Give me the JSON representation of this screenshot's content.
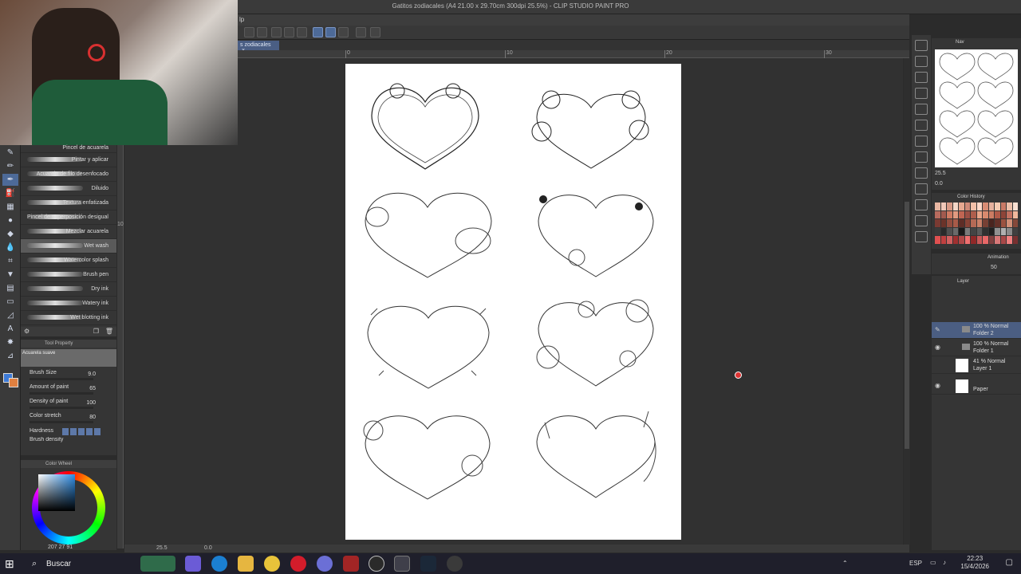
{
  "window": {
    "title": "Gatitos zodiacales (A4 21.00 x 29.70cm 300dpi 25.5%) - CLIP STUDIO PAINT PRO"
  },
  "menu": {
    "partial_label": "lp"
  },
  "document_tab": {
    "label": "s zodiacales",
    "close": "×"
  },
  "ruler": {
    "labels": [
      "0",
      "10",
      "20",
      "30"
    ],
    "left_label": "10"
  },
  "brushes": [
    {
      "label": "Pincel de acuarela"
    },
    {
      "label": "Pintar y aplicar"
    },
    {
      "label": "Acuarela de filo desenfocado"
    },
    {
      "label": "Diluido"
    },
    {
      "label": "Textura enfatizada"
    },
    {
      "label": "Pincel de superposición desigual"
    },
    {
      "label": "Mezclar acuarela"
    },
    {
      "label": "Wet wash"
    },
    {
      "label": "Watercolor splash"
    },
    {
      "label": "Brush pen"
    },
    {
      "label": "Dry ink"
    },
    {
      "label": "Watery ink"
    },
    {
      "label": "Wet blotting ink"
    }
  ],
  "tool_property": {
    "title": "Tool Property",
    "preset": "Acuarela suave",
    "props": [
      {
        "name": "Brush Size",
        "value": "9.0"
      },
      {
        "name": "Amount of paint",
        "value": "65"
      },
      {
        "name": "Density of paint",
        "value": "100"
      },
      {
        "name": "Color stretch",
        "value": "80"
      }
    ],
    "hardness_label": "Hardness",
    "cut_label": "Brush density"
  },
  "color_wheel": {
    "title": "Color Wheel",
    "values": "207 27 91"
  },
  "navigator": {
    "title": "Nav",
    "zoom": "25.5",
    "rotation": "0.0"
  },
  "color_history": {
    "title": "Color History",
    "colors": [
      "#e8b6a2",
      "#f0c8b8",
      "#d99a86",
      "#f4d6c6",
      "#e6a890",
      "#cf8a78",
      "#f2c0a8",
      "#ffd9c9",
      "#d88c74",
      "#e7b29e",
      "#f6cbb2",
      "#c97a66",
      "#ecbfa9",
      "#fae0d2",
      "#b86b5e",
      "#a35a4e",
      "#d07a62",
      "#e29a80",
      "#c06552",
      "#9c4f44",
      "#ae5e4c",
      "#e8a488",
      "#d88a6e",
      "#cc7c62",
      "#b05a48",
      "#8e4438",
      "#c27060",
      "#f0b89c",
      "#7a3a32",
      "#6b3329",
      "#934d3f",
      "#a85a48",
      "#5e2d26",
      "#874235",
      "#b56a56",
      "#c98068",
      "#774034",
      "#4a241e",
      "#633028",
      "#9b5240",
      "#d29078",
      "#86493a",
      "#3a3a3a",
      "#2a2a2a",
      "#505050",
      "#6a6a6a",
      "#1a1a1a",
      "#7a7a7a",
      "#444444",
      "#5a5a5a",
      "#303030",
      "#202020",
      "#909090",
      "#b0b0b0",
      "#8a8a8a",
      "#404040",
      "#e05050",
      "#c04040",
      "#d06060",
      "#a03030",
      "#b04848",
      "#f07070",
      "#902828",
      "#c85858",
      "#e86868",
      "#804040",
      "#d87878",
      "#a84848",
      "#f08080",
      "#783030"
    ]
  },
  "animation": {
    "title": "Animation",
    "opacity": "50"
  },
  "layer_panel": {
    "title": "Layer",
    "layers": [
      {
        "line1": "100 % Normal",
        "line2": "Folder 2",
        "type": "folder",
        "selected": true
      },
      {
        "line1": "100 % Normal",
        "line2": "Folder 1",
        "type": "folder",
        "selected": false
      },
      {
        "line1": "41 % Normal",
        "line2": "Layer 1",
        "type": "raster",
        "selected": false
      },
      {
        "line1": "",
        "line2": "Paper",
        "type": "paper",
        "selected": false
      }
    ]
  },
  "statusbar": {
    "zoom": "25.5",
    "angle": "0.0"
  },
  "taskbar": {
    "search_placeholder": "Buscar",
    "lang": "ESP",
    "time": "22:23",
    "date": "15/4/2026",
    "apps": [
      "copilot",
      "edge",
      "file-explorer",
      "chrome",
      "opera",
      "discord",
      "game",
      "obs",
      "clip-studio",
      "steam",
      "app"
    ]
  }
}
